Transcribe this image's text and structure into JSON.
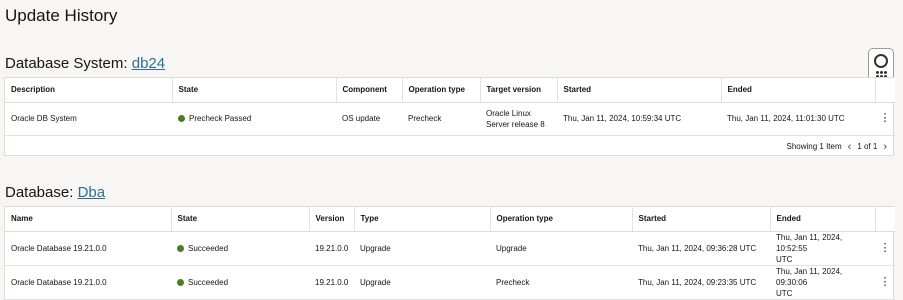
{
  "page": {
    "title": "Update History"
  },
  "db_system": {
    "label": "Database System:",
    "link": "db24",
    "columns": [
      "Description",
      "State",
      "Component",
      "Operation type",
      "Target version",
      "Started",
      "Ended"
    ],
    "rows": [
      {
        "description": "Oracle DB System",
        "state": "Precheck Passed",
        "component": "OS update",
        "operation": "Precheck",
        "target_line1": "Oracle Linux",
        "target_line2": "Server release 8",
        "started": "Thu, Jan 11, 2024, 10:59:34 UTC",
        "ended": "Thu, Jan 11, 2024, 11:01:30 UTC"
      }
    ],
    "footer": {
      "showing": "Showing 1 Item",
      "page": "1 of 1"
    }
  },
  "database": {
    "label": "Database:",
    "link": "Dba",
    "columns": [
      "Name",
      "State",
      "Version",
      "Type",
      "Operation type",
      "Started",
      "Ended"
    ],
    "rows": [
      {
        "name": "Oracle Database 19.21.0.0",
        "state": "Succeeded",
        "version": "19.21.0.0",
        "type": "Upgrade",
        "operation": "Upgrade",
        "started": "Thu, Jan 11, 2024, 09:36:28 UTC",
        "ended_line1": "Thu, Jan 11, 2024, 10:52:55",
        "ended_line2": "UTC"
      },
      {
        "name": "Oracle Database 19.21.0.0",
        "state": "Succeeded",
        "version": "19.21.0.0",
        "type": "Upgrade",
        "operation": "Precheck",
        "started": "Thu, Jan 11, 2024, 09:23:35 UTC",
        "ended_line1": "Thu, Jan 11, 2024, 09:30:06",
        "ended_line2": "UTC"
      }
    ]
  },
  "icons": {
    "help": "help-lifebuoy-icon",
    "kebab": "kebab-menu-icon",
    "success": "status-success-icon",
    "prev": "chevron-left-icon",
    "next": "chevron-right-icon"
  },
  "colors": {
    "success": "#4d7b2a",
    "link": "#2f6e8f"
  }
}
